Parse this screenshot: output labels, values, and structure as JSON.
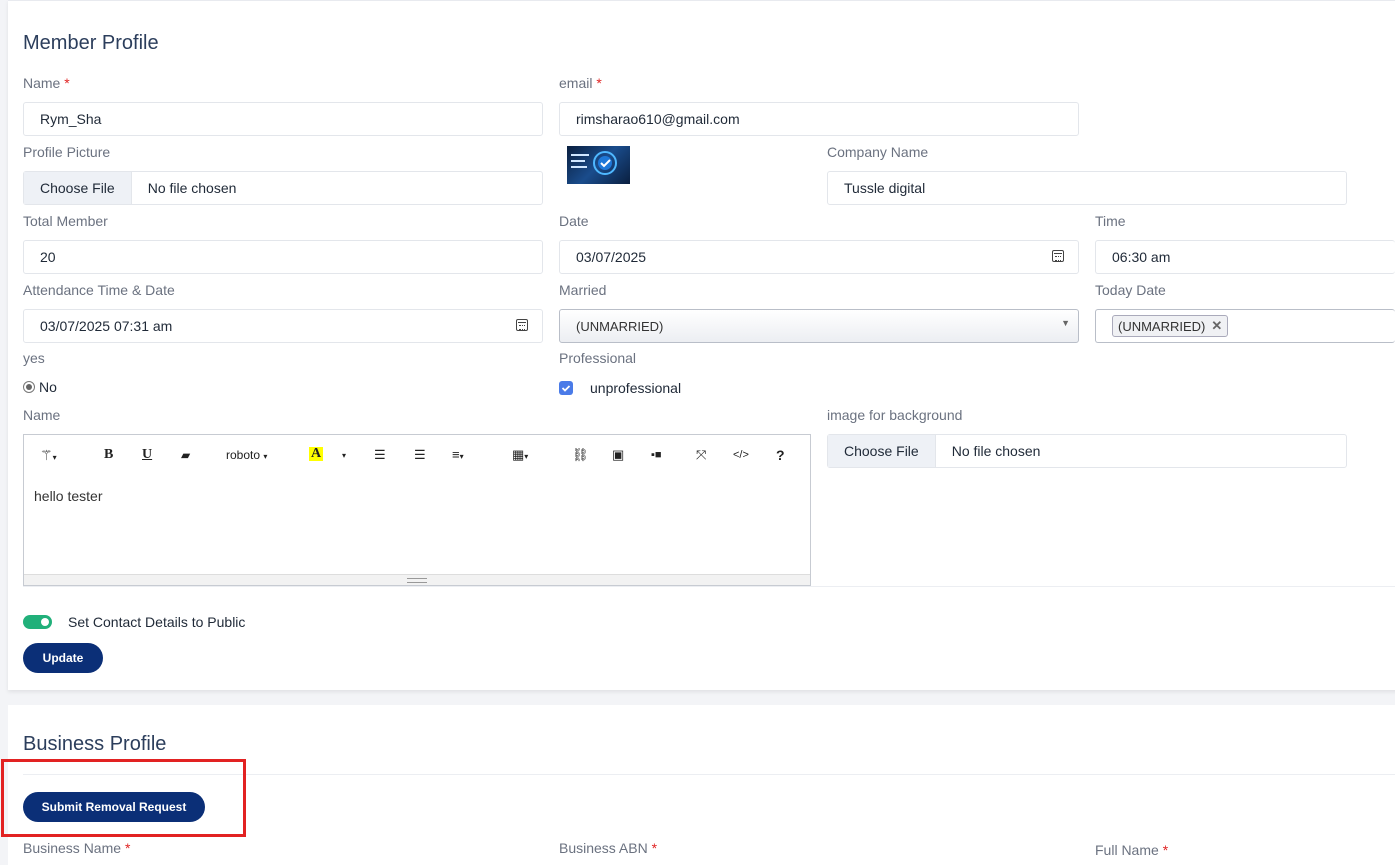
{
  "member_profile": {
    "title": "Member Profile",
    "name_label": "Name",
    "name_value": "Rym_Sha",
    "email_label": "email",
    "email_value": "rimsharao610@gmail.com",
    "profile_picture_label": "Profile Picture",
    "file_choose_label": "Choose File",
    "file_status": "No file chosen",
    "company_name_label": "Company Name",
    "company_name_value": "Tussle digital",
    "total_member_label": "Total Member",
    "total_member_value": "20",
    "date_label": "Date",
    "date_value": "03/07/2025",
    "time_label": "Time",
    "time_value": "06:30  am",
    "attendance_label": "Attendance Time & Date",
    "attendance_value": "03/07/2025 07:31  am",
    "married_label": "Married",
    "married_value": "(UNMARRIED)",
    "today_date_label": "Today Date",
    "today_date_tag": "(UNMARRIED)",
    "yes_label": "yes",
    "radio_no_label": "No",
    "professional_label": "Professional",
    "professional_checkbox_label": "unprofessional",
    "editor_label": "Name",
    "editor_font": "roboto",
    "editor_content": "hello tester",
    "bg_image_label": "image for background",
    "bg_file_choose_label": "Choose File",
    "bg_file_status": "No file chosen",
    "public_toggle_label": "Set Contact Details to Public",
    "update_button": "Update"
  },
  "business_profile": {
    "title": "Business Profile",
    "submit_removal_button": "Submit Removal Request",
    "business_name_label": "Business Name",
    "business_abn_label": "Business ABN",
    "full_name_label": "Full Name"
  },
  "colors": {
    "primary": "#0b2f77",
    "toggle_on": "#21b07a",
    "required": "#e02424",
    "highlight": "#e22222",
    "checkbox": "#4a7be8"
  },
  "icons": [
    "calendar-icon",
    "magic-wand-icon",
    "bold-icon",
    "underline-icon",
    "eraser-icon",
    "font-color-icon",
    "unordered-list-icon",
    "ordered-list-icon",
    "align-icon",
    "table-icon",
    "link-icon",
    "picture-icon",
    "video-icon",
    "fullscreen-icon",
    "code-view-icon",
    "help-icon",
    "remove-tag-icon"
  ]
}
